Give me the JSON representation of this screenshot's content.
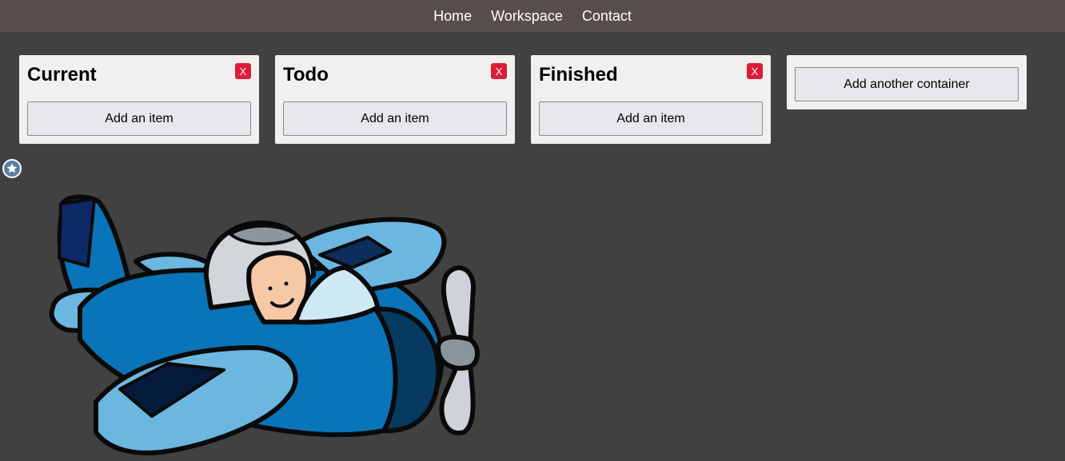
{
  "nav": {
    "items": [
      "Home",
      "Workspace",
      "Contact"
    ]
  },
  "containers": [
    {
      "title": "Current",
      "close_label": "X",
      "add_label": "Add an item"
    },
    {
      "title": "Todo",
      "close_label": "X",
      "add_label": "Add an item"
    },
    {
      "title": "Finished",
      "close_label": "X",
      "add_label": "Add an item"
    }
  ],
  "add_container": {
    "label": "Add another container"
  },
  "colors": {
    "nav_bg": "#574d4c",
    "page_bg": "#414141",
    "card_bg": "#f0f0f0",
    "close_red": "#dc1d35"
  },
  "icons": {
    "badge": "star-badge-icon",
    "illustration": "cartoon-airplane-pilot"
  }
}
